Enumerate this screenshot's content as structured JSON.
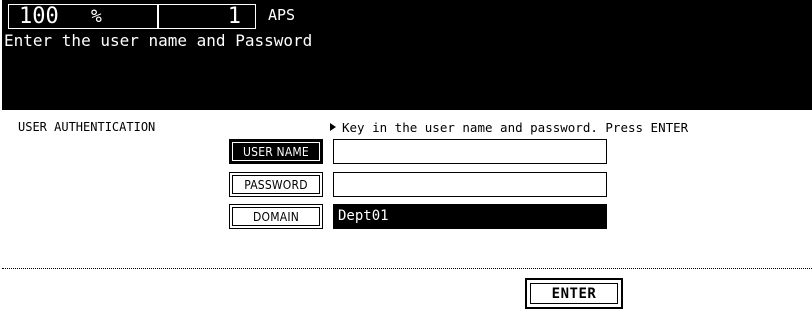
{
  "status": {
    "zoom_value": "100",
    "zoom_unit": "%",
    "copies": "1",
    "paper_mode": "APS",
    "prompt": "Enter the user name and Password"
  },
  "auth": {
    "section_title": "USER AUTHENTICATION",
    "instruction": "Key in the user name and password. Press ENTER",
    "fields": [
      {
        "label": "USER NAME",
        "value": "",
        "active": true
      },
      {
        "label": "PASSWORD",
        "value": "",
        "active": false
      },
      {
        "label": "DOMAIN",
        "value": "Dept01",
        "active": false
      }
    ],
    "enter_label": "ENTER"
  }
}
